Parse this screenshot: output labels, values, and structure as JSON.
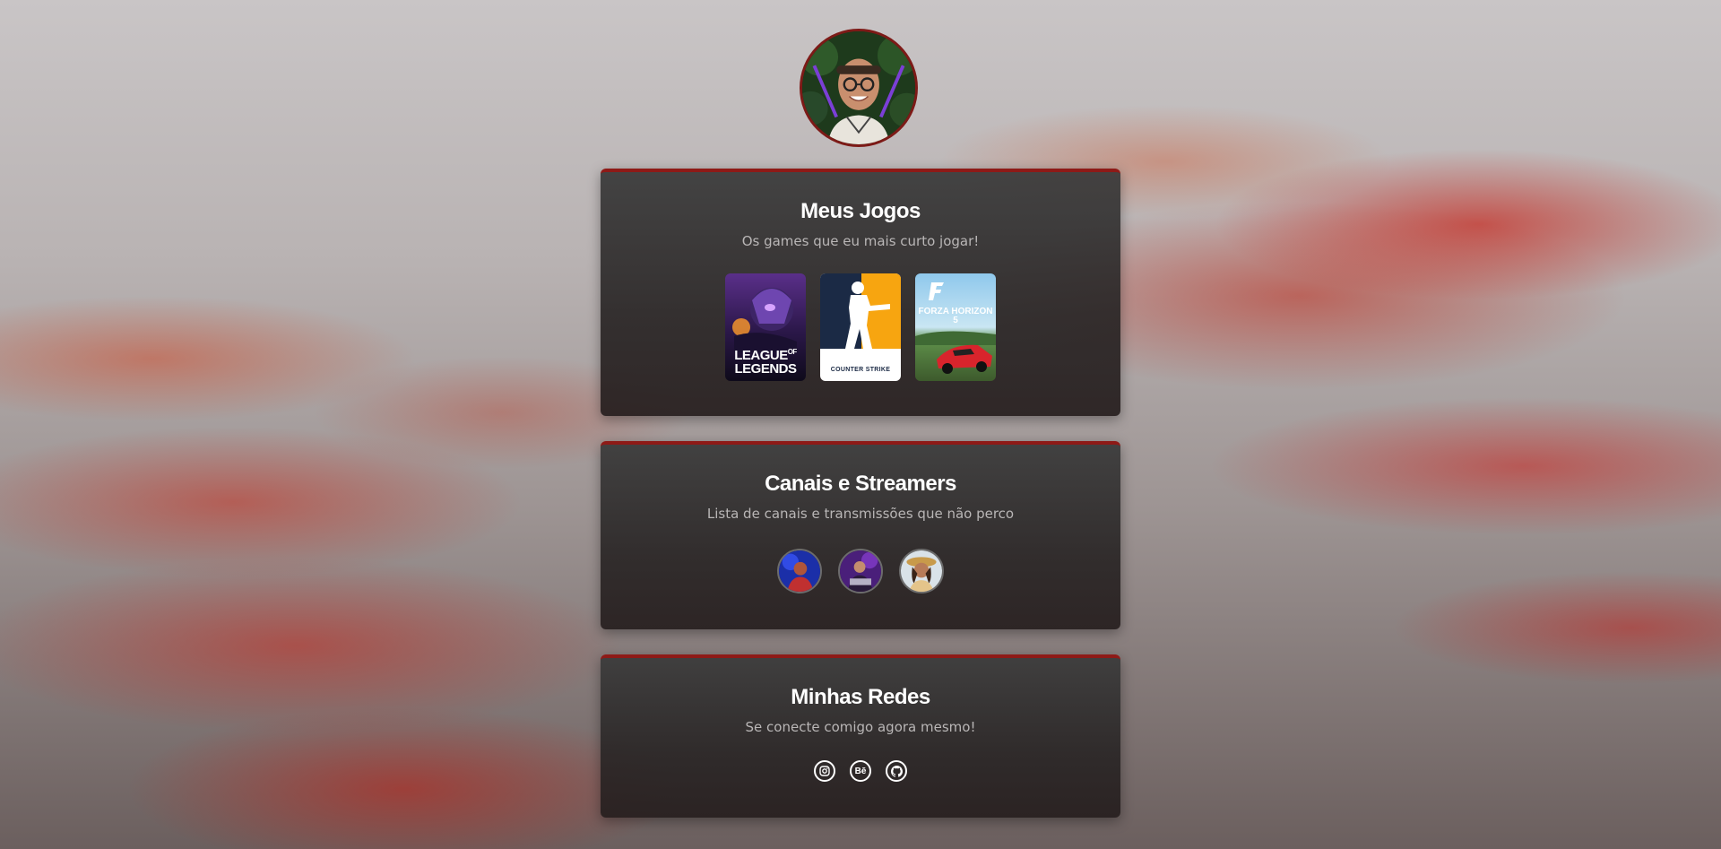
{
  "profile": {
    "avatar_icon": "profile-photo"
  },
  "games_section": {
    "title": "Meus Jogos",
    "subtitle": "Os games que eu mais curto jogar!",
    "games": [
      {
        "name": "League of Legends",
        "cover_text_1": "LEAGUE",
        "cover_text_2": "LEGENDS",
        "cover_text_of": "OF"
      },
      {
        "name": "Counter Strike",
        "cover_text": "COUNTER STRIKE"
      },
      {
        "name": "Forza Horizon 5",
        "cover_text": "FORZA HORIZON 5"
      }
    ]
  },
  "streamers_section": {
    "title": "Canais e Streamers",
    "subtitle": "Lista de canais e transmissões que não perco",
    "streamers": [
      {
        "icon": "streamer-avatar"
      },
      {
        "icon": "streamer-avatar"
      },
      {
        "icon": "streamer-avatar"
      }
    ]
  },
  "social_section": {
    "title": "Minhas Redes",
    "subtitle": "Se conecte comigo agora mesmo!",
    "links": [
      {
        "icon": "instagram-icon"
      },
      {
        "icon": "behance-icon",
        "text": "Bē"
      },
      {
        "icon": "github-icon"
      }
    ]
  },
  "colors": {
    "accent": "#8e1a17",
    "card_bg": "#3a3838",
    "text": "#ffffff",
    "muted": "#b9b6b6"
  }
}
